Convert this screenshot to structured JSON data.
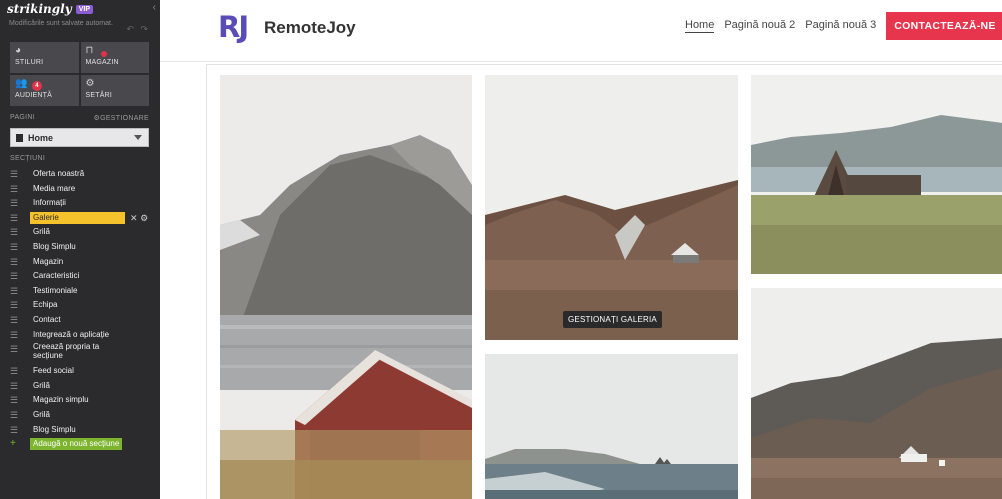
{
  "sidebar": {
    "brand": "strikingly",
    "plan_badge": "VIP",
    "save_status": "Modificările sunt salvate automat.",
    "tiles": [
      {
        "label": "STILURI",
        "icon": "palette-icon",
        "glyph": "◕"
      },
      {
        "label": "MAGAZIN",
        "icon": "basket-icon",
        "glyph": "⊓"
      },
      {
        "label": "AUDIENȚĂ",
        "icon": "users-icon",
        "glyph": "👥",
        "badge": "4"
      },
      {
        "label": "SETĂRI",
        "icon": "gear-icon",
        "glyph": "⚙"
      }
    ],
    "pages_label": "PAGINI",
    "manage_label": "GESTIONARE",
    "current_page": "Home",
    "sections_label": "SECȚIUNI",
    "sections": [
      "Oferta noastră",
      "Media mare",
      "Informații",
      "Galerie",
      "Grilă",
      "Blog Simplu",
      "Magazin",
      "Caracteristici",
      "Testimoniale",
      "Echipa",
      "Contact",
      "Integrează o aplicație",
      "Creează propria ta secțiune",
      "Feed social",
      "Grilă",
      "Magazin simplu",
      "Grilă",
      "Blog Simplu"
    ],
    "active_section_index": 3,
    "add_section_label": "Adaugă o nouă secțiune"
  },
  "site": {
    "logo_text": "RJ",
    "name": "RemoteJoy",
    "nav": [
      "Home",
      "Pagină nouă 2",
      "Pagină nouă 3"
    ],
    "cta_label": "CONTACTEAZĂ-NE"
  },
  "gallery": {
    "manage_label": "GESTIONAȚI GALERIA"
  },
  "colors": {
    "sidebar_bg": "#2b2b2e",
    "active_section": "#f5c22b",
    "add_section": "#7db42f",
    "cta": "#e6354d",
    "logo": "#5b4bb7"
  }
}
